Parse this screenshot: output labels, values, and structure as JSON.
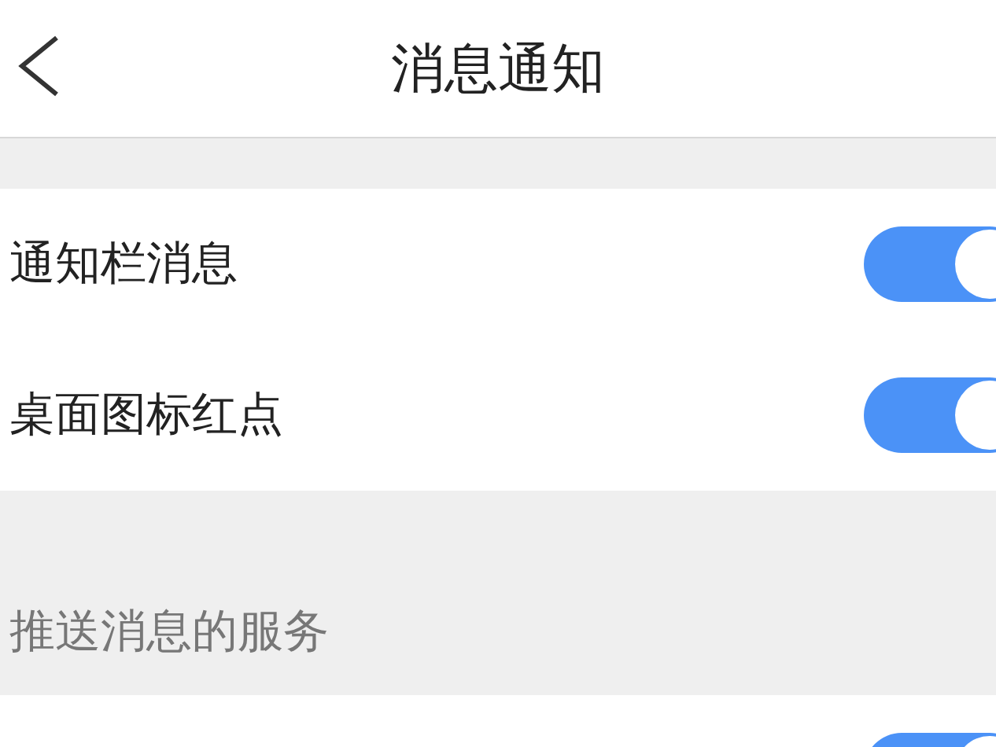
{
  "header": {
    "title": "消息通知"
  },
  "settings": [
    {
      "label": "通知栏消息",
      "on": true
    },
    {
      "label": "桌面图标红点",
      "on": true
    }
  ],
  "push_section": {
    "heading": "推送消息的服务",
    "items": [
      {
        "on": true
      }
    ]
  }
}
